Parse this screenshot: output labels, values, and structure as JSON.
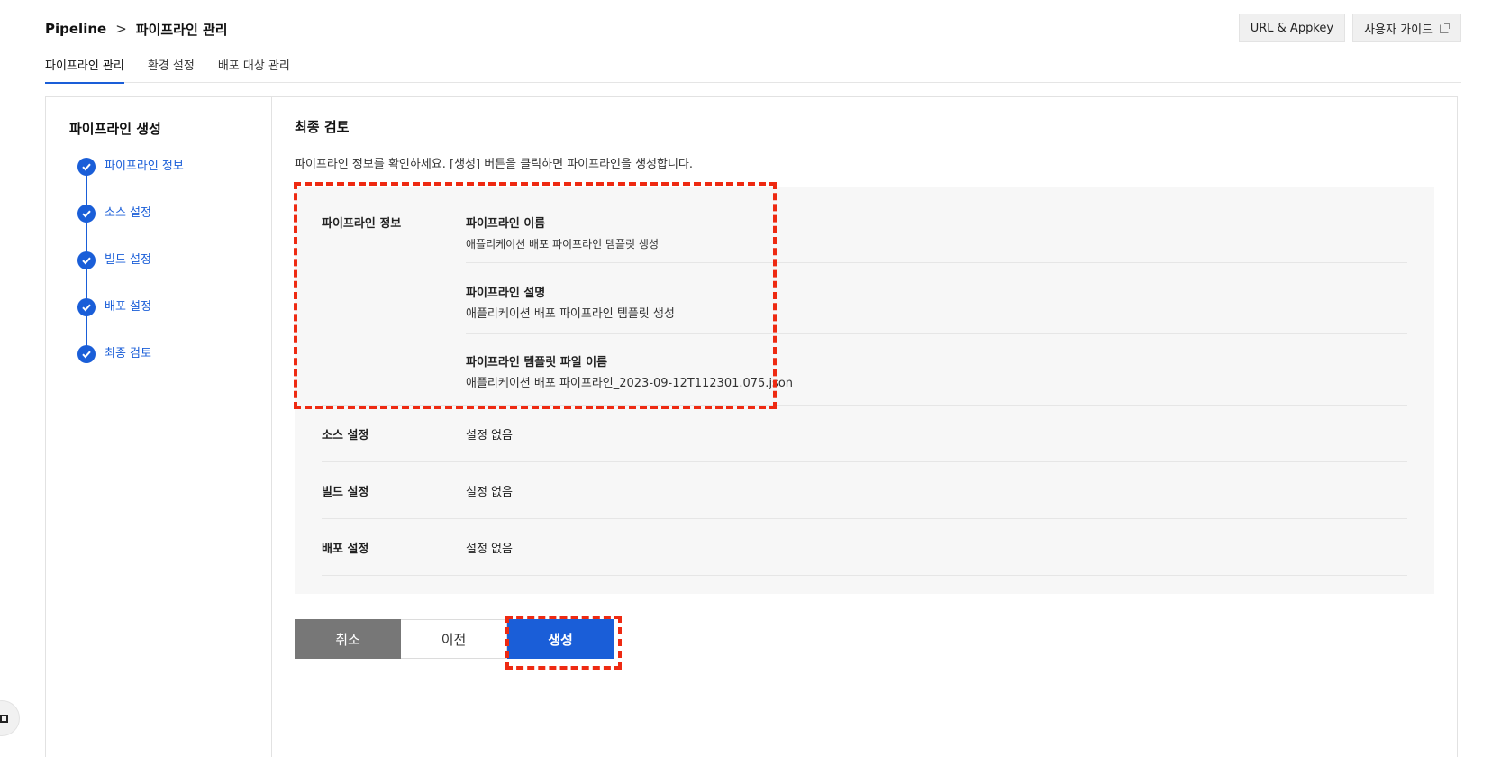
{
  "breadcrumb": {
    "root": "Pipeline",
    "separator": ">",
    "current": "파이프라인 관리"
  },
  "header_actions": {
    "url_appkey": "URL & Appkey",
    "user_guide": "사용자 가이드"
  },
  "tabs": [
    {
      "label": "파이프라인 관리",
      "active": true
    },
    {
      "label": "환경 설정",
      "active": false
    },
    {
      "label": "배포 대상 관리",
      "active": false
    }
  ],
  "wizard": {
    "title": "파이프라인 생성",
    "steps": [
      {
        "label": "파이프라인 정보",
        "completed": true
      },
      {
        "label": "소스 설정",
        "completed": true
      },
      {
        "label": "빌드 설정",
        "completed": true
      },
      {
        "label": "배포 설정",
        "completed": true
      },
      {
        "label": "최종 검토",
        "completed": true
      }
    ]
  },
  "review": {
    "title": "최종 검토",
    "description": "파이프라인 정보를 확인하세요. [생성] 버튼을 클릭하면 파이프라인을 생성합니다.",
    "pipeline_info": {
      "label": "파이프라인 정보",
      "fields": [
        {
          "label": "파이프라인 이름",
          "value": "애플리케이션 배포 파이프라인 템플릿 생성"
        },
        {
          "label": "파이프라인 설명",
          "value": "애플리케이션 배포 파이프라인 템플릿 생성"
        },
        {
          "label": "파이프라인 템플릿 파일 이름",
          "value": "애플리케이션 배포 파이프라인_2023-09-12T112301.075.json"
        }
      ]
    },
    "source": {
      "label": "소스 설정",
      "value": "설정 없음"
    },
    "build": {
      "label": "빌드 설정",
      "value": "설정 없음"
    },
    "deploy": {
      "label": "배포 설정",
      "value": "설정 없음"
    }
  },
  "actions": {
    "cancel": "취소",
    "previous": "이전",
    "create": "생성"
  },
  "colors": {
    "accent": "#1a5ed8",
    "highlight": "#ee2a12",
    "cancel_bg": "#777777"
  }
}
